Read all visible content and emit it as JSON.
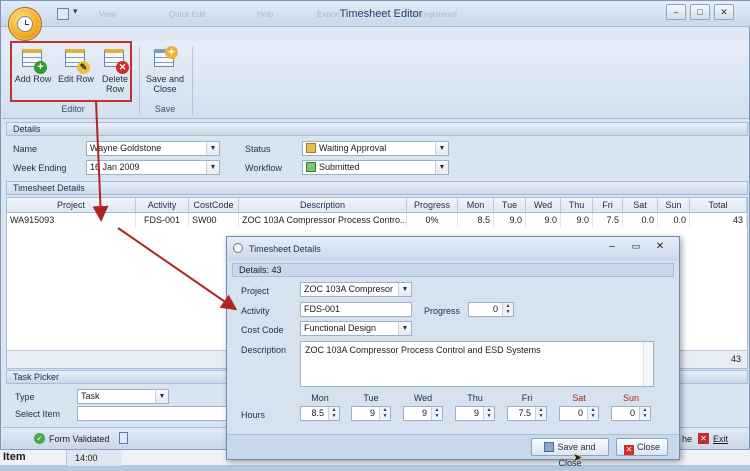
{
  "window": {
    "title": "Timesheet Editor",
    "ghost_tabs": [
      "View",
      "Quick Edit",
      "Help",
      "Export",
      "Unregistered"
    ]
  },
  "ribbon": {
    "editor_group": {
      "label": "Editor",
      "buttons": [
        {
          "label": "Add Row",
          "icon": "add-row-icon"
        },
        {
          "label": "Edit Row",
          "icon": "edit-row-icon"
        },
        {
          "label": "Delete Row",
          "icon": "delete-row-icon"
        }
      ]
    },
    "save_group": {
      "label": "Save",
      "button": {
        "label": "Save and Close",
        "icon": "save-close-icon"
      }
    }
  },
  "details": {
    "header": "Details",
    "name_label": "Name",
    "name_value": "Wayne Goldstone",
    "week_label": "Week Ending",
    "week_value": "16 Jan 2009",
    "status_label": "Status",
    "status_value": "Waiting Approval",
    "workflow_label": "Workflow",
    "workflow_value": "Submitted"
  },
  "timesheet": {
    "header": "Timesheet Details",
    "columns": [
      "Project",
      "Activity",
      "CostCode",
      "Description",
      "Progress",
      "Mon",
      "Tue",
      "Wed",
      "Thu",
      "Fri",
      "Sat",
      "Sun",
      "Total"
    ],
    "rows": [
      [
        "WA915093",
        "FDS-001",
        "SW00",
        "ZOC 103A Compressor Process Contro...",
        "0%",
        "8.5",
        "9.0",
        "9.0",
        "9.0",
        "7.5",
        "0.0",
        "0.0",
        "43"
      ]
    ],
    "footer_total": "43"
  },
  "task_picker": {
    "header": "Task Picker",
    "type_label": "Type",
    "type_value": "Task",
    "select_label": "Select Item"
  },
  "statusbar": {
    "validated": "Form Validated",
    "partial_label": "he",
    "exit": "Exit"
  },
  "behind": {
    "item_label": "Item",
    "time": "14:00"
  },
  "dialog": {
    "title": "Timesheet Details",
    "details_count": "Details: 43",
    "project_label": "Project",
    "project_value": "ZOC 103A Compresor",
    "activity_label": "Activity",
    "activity_value": "FDS-001",
    "progress_label": "Progress",
    "progress_value": "0",
    "costcode_label": "Cost Code",
    "costcode_value": "Functional Design",
    "description_label": "Description",
    "description_value": "ZOC 103A Compressor Process Control and ESD Systems",
    "hours_label": "Hours",
    "days": [
      "Mon",
      "Tue",
      "Wed",
      "Thu",
      "Fri",
      "Sat",
      "Sun"
    ],
    "hours": [
      "8.5",
      "9",
      "9",
      "9",
      "7.5",
      "0",
      "0"
    ],
    "save_button": "Save and Close",
    "close_button": "Close"
  },
  "colors": {
    "highlight_box": "#c23030",
    "arrow": "#b02424",
    "weekend_label": "#b01e1e"
  }
}
